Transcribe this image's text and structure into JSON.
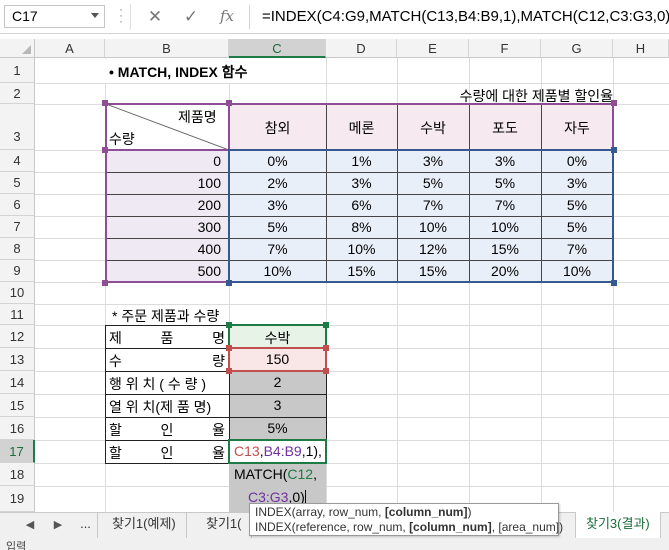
{
  "colors": {
    "purple": "#8e4e93",
    "blue": "#365a8f",
    "green": "#1d7b45",
    "red": "#c0504d",
    "ref_purple": "#7030a0",
    "ref_blue": "#4472c4"
  },
  "formula_bar": {
    "name_box": "C17",
    "cancel_icon": "cancel-icon",
    "enter_icon": "check-icon",
    "fx": "fx",
    "formula": "=INDEX(C4:G9,MATCH(C13,B4:B9,1),MATCH(C12,C3:G3,0)"
  },
  "columns": [
    "A",
    "B",
    "C",
    "D",
    "E",
    "F",
    "G",
    "H"
  ],
  "rows": [
    "1",
    "2",
    "3",
    "4",
    "5",
    "6",
    "7",
    "8",
    "9",
    "10",
    "11",
    "12",
    "13",
    "14",
    "15",
    "16",
    "17",
    "18",
    "19"
  ],
  "sheet": {
    "title": "• MATCH, INDEX 함수",
    "subtitle": "수량에 대한 제품별 할인율",
    "corner_product": "제품명",
    "corner_qty": "수량",
    "products": [
      "참외",
      "메론",
      "수박",
      "포도",
      "자두"
    ],
    "quantities": [
      "0",
      "100",
      "200",
      "300",
      "400",
      "500"
    ],
    "rates": [
      [
        "0%",
        "1%",
        "3%",
        "3%",
        "0%"
      ],
      [
        "2%",
        "3%",
        "5%",
        "5%",
        "3%"
      ],
      [
        "3%",
        "6%",
        "7%",
        "7%",
        "5%"
      ],
      [
        "5%",
        "8%",
        "10%",
        "10%",
        "5%"
      ],
      [
        "7%",
        "10%",
        "12%",
        "15%",
        "7%"
      ],
      [
        "10%",
        "15%",
        "15%",
        "20%",
        "10%"
      ]
    ],
    "order_title": "*  주문 제품과 수량",
    "order_labels": [
      [
        "제",
        "품",
        "명"
      ],
      [
        "수",
        "량"
      ],
      [
        "행 위 치 ( 수 량 )"
      ],
      [
        "열 위 치(제 품 명)"
      ],
      [
        "할",
        "인",
        "율"
      ],
      [
        "할",
        "인",
        "율"
      ]
    ],
    "order_values": [
      "수박",
      "150",
      "2",
      "3",
      "5%"
    ],
    "edit_line1": {
      "p1": "C13",
      "p2": ",",
      "p3": "B4:B9",
      "p4": ",1),"
    },
    "edit_line2": {
      "p1": "MATCH(",
      "p2": "C12",
      "p3": ","
    },
    "edit_line3": {
      "p1": "C3:G3",
      "p2": ",0)"
    }
  },
  "tooltip": {
    "line1_a": "INDEX(array, row_num, ",
    "line1_b": "[column_num]",
    "line1_c": ")",
    "line2_a": "INDEX(reference, row_num, ",
    "line2_b": "[column_num]",
    "line2_c": ", [area_num])"
  },
  "tabs": {
    "nav_prev_icon": "tab-prev-icon",
    "nav_next_icon": "tab-next-icon",
    "more": "...",
    "tab1": "찾기1(예제)",
    "tab2": "찾기1(",
    "tab3": "찾기3(결과)"
  },
  "status": "입력"
}
